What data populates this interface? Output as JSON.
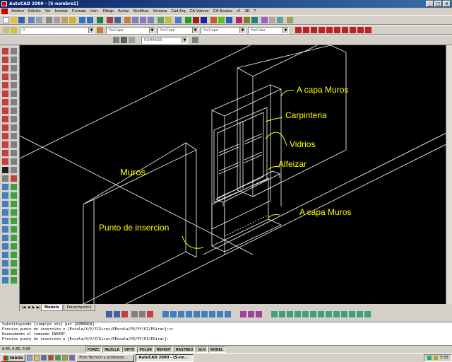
{
  "window": {
    "title": "AutoCAD 2000 - [S-nombre1]",
    "buttons": [
      "_",
      "□",
      "×"
    ]
  },
  "menubar": {
    "items": [
      "Archivo",
      "Edición",
      "Ver",
      "Insertar",
      "Formato",
      "Herr.",
      "Dibujo",
      "Acotar",
      "Modificar",
      "Ventana",
      "Cad-Arq",
      "CA-Valores",
      "CA-Ayudas",
      "v2",
      "3D",
      "?"
    ]
  },
  "properties": {
    "layer_value": "0",
    "color_value": "PorCapa",
    "linetype_value": "PorCapa",
    "lineweight_value": "PorCapa",
    "plotstyle_value": "PorColor",
    "textstyle_value": "ROMANS8"
  },
  "drawing": {
    "labels": {
      "muros_left": "Muros",
      "punto_insercion": "Punto de insercion",
      "capa_muros_top": "A capa Muros",
      "carpinteria": "Carpinteria",
      "vidrios": "Vidrios",
      "alfeizar": "Alfeizar",
      "capa_muros_bottom": "A capa Muros"
    },
    "label_color": "#ffff00",
    "line_color": "#ffffff",
    "background": "#000000"
  },
  "layout_tabs": {
    "tabs": [
      "Modelo",
      "Presentación1"
    ],
    "active": "Modelo"
  },
  "command_line": {
    "lines": [
      "Substituyendo [simplex shx] por [ROMANS8]",
      "Precise punto de inserción o [Escala/X/Y/Z/Girar/PEscala/PX/PY/PZ/PGirar]:>>",
      "Reanudando el comando INSERT.",
      "Precise punto de inserción o [Escala/X/Y/Z/Girar/PEscala/PX/PY/PZ/PGirar]:"
    ]
  },
  "statusbar": {
    "coords": "6.85, 6.65, 0.00",
    "toggles": [
      "FORZC",
      "REJILLA",
      "ORTO",
      "POLAR",
      "REFENT",
      "RASTREO",
      "GLN",
      "MODEL"
    ]
  },
  "taskbar": {
    "start_label": "Inicio",
    "tasks": [
      "Foro Tecnico y profesion...",
      "AutoCAD 2000 - [S-no..."
    ],
    "active_task": 1,
    "clock": "3:55"
  }
}
